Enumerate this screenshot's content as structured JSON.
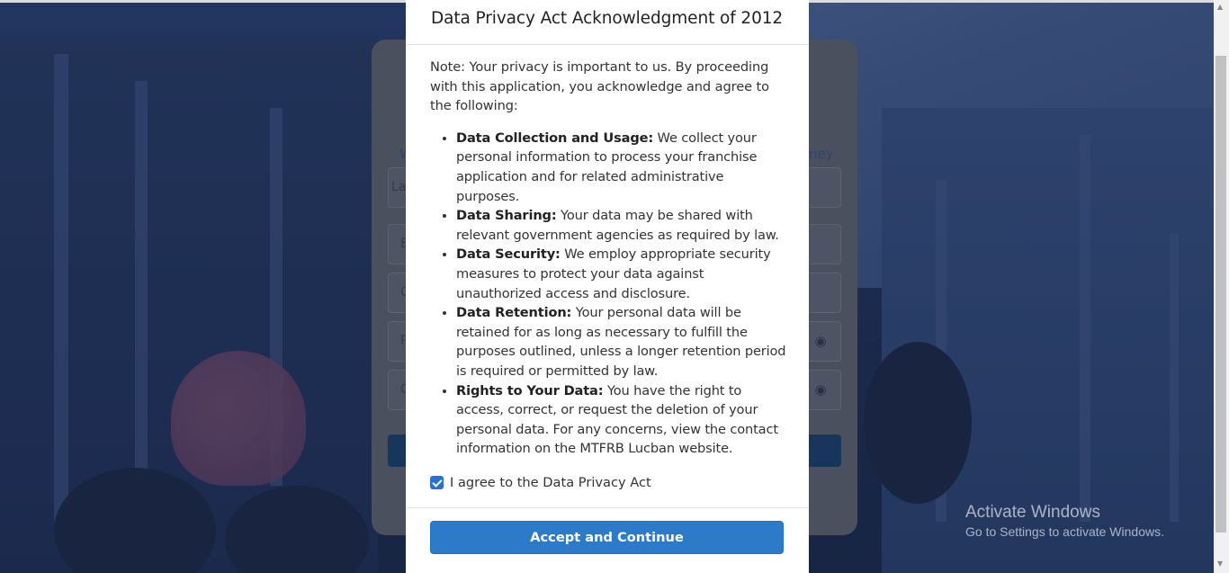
{
  "modal": {
    "title": "Data Privacy Act Acknowledgment of 2012",
    "note": "Note: Your privacy is important to us. By proceeding with this application, you acknowledge and agree to the following:",
    "items": [
      {
        "heading": "Data Collection and Usage:",
        "text": " We collect your personal information to process your franchise application and for related administrative purposes."
      },
      {
        "heading": "Data Sharing:",
        "text": " Your data may be shared with relevant government agencies as required by law."
      },
      {
        "heading": "Data Security:",
        "text": " We employ appropriate security measures to protect your data against unauthorized access and disclosure."
      },
      {
        "heading": "Data Retention:",
        "text": " Your personal data will be retained for as long as necessary to fulfill the purposes outlined, unless a longer retention period is required or permitted by law."
      },
      {
        "heading": "Rights to Your Data:",
        "text": " You have the right to access, correct, or request the deletion of your personal data. For any concerns, view the contact information on the MTFRB Lucban website."
      }
    ],
    "agree_label": "I agree to the Data Privacy Act",
    "agree_checked": true,
    "accept_button": "Accept and Continue"
  },
  "background_card": {
    "link_left": "W",
    "link_right": "ney",
    "field_placeholders": [
      "La",
      "E",
      "C",
      "P",
      "C"
    ]
  },
  "watermark": {
    "line1": "Activate Windows",
    "line2": "Go to Settings to activate Windows."
  },
  "colors": {
    "accent": "#2d7bc8",
    "checkbox": "#2a6fd1"
  }
}
